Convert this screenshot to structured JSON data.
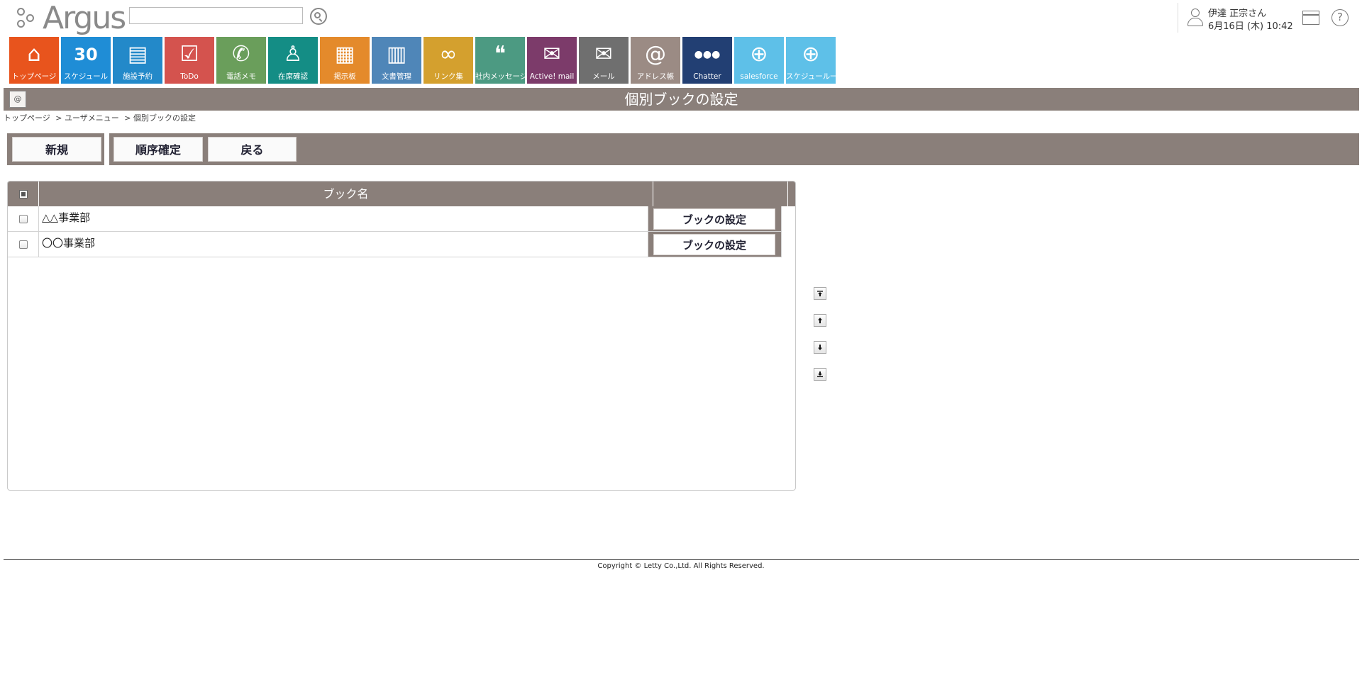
{
  "header": {
    "logo_text": "Argus",
    "search_placeholder": "",
    "user_name": "伊達 正宗さん",
    "datetime": "6月16日 (木) 10:42"
  },
  "apps": [
    {
      "label": "トップページ",
      "icon": "home-icon",
      "color": "#e8541d",
      "glyph": "⌂"
    },
    {
      "label": "スケジュール",
      "icon": "calendar-icon",
      "color": "#1f8dd6",
      "glyph": "30"
    },
    {
      "label": "施設予約",
      "icon": "facility-icon",
      "color": "#2389c9",
      "glyph": "▤"
    },
    {
      "label": "ToDo",
      "icon": "todo-icon",
      "color": "#d4534e",
      "glyph": "☑"
    },
    {
      "label": "電話メモ",
      "icon": "phone-icon",
      "color": "#6a9e5b",
      "glyph": "✆"
    },
    {
      "label": "在席確認",
      "icon": "presence-icon",
      "color": "#148d85",
      "glyph": "♙"
    },
    {
      "label": "掲示板",
      "icon": "bulletin-icon",
      "color": "#e48a2b",
      "glyph": "▦"
    },
    {
      "label": "文書管理",
      "icon": "document-icon",
      "color": "#4f86b8",
      "glyph": "▥"
    },
    {
      "label": "リンク集",
      "icon": "link-icon",
      "color": "#d4a02e",
      "glyph": "∞"
    },
    {
      "label": "社内メッセージ",
      "icon": "message-icon",
      "color": "#4c9a82",
      "glyph": "❝"
    },
    {
      "label": "Active! mail",
      "icon": "activemail-icon",
      "color": "#7c3b6a",
      "glyph": "✉"
    },
    {
      "label": "メール",
      "icon": "mail-icon",
      "color": "#6f6f6f",
      "glyph": "✉"
    },
    {
      "label": "アドレス帳",
      "icon": "addressbook-icon",
      "color": "#9b8b84",
      "glyph": "@"
    },
    {
      "label": "Chatter",
      "icon": "chatter-icon",
      "color": "#223f73",
      "glyph": "●●●"
    },
    {
      "label": "salesforce",
      "icon": "globe-icon",
      "color": "#5ec0e8",
      "glyph": "⊕"
    },
    {
      "label": "スケジュール一",
      "icon": "globe-icon",
      "color": "#5ec0e8",
      "glyph": "⊕"
    }
  ],
  "page": {
    "title": "個別ブックの設定",
    "breadcrumb": [
      "トップページ",
      "> ユーザメニュー",
      "> 個別ブックの設定"
    ]
  },
  "toolbar": {
    "new_label": "新規",
    "confirm_order_label": "順序確定",
    "back_label": "戻る"
  },
  "table": {
    "header_name": "ブック名",
    "rows": [
      {
        "name": "△△事業部",
        "action": "ブックの設定"
      },
      {
        "name": "〇〇事業部",
        "action": "ブックの設定"
      }
    ]
  },
  "footer": {
    "copyright": "Copyright © Letty Co.,Ltd. All Rights Reserved."
  }
}
